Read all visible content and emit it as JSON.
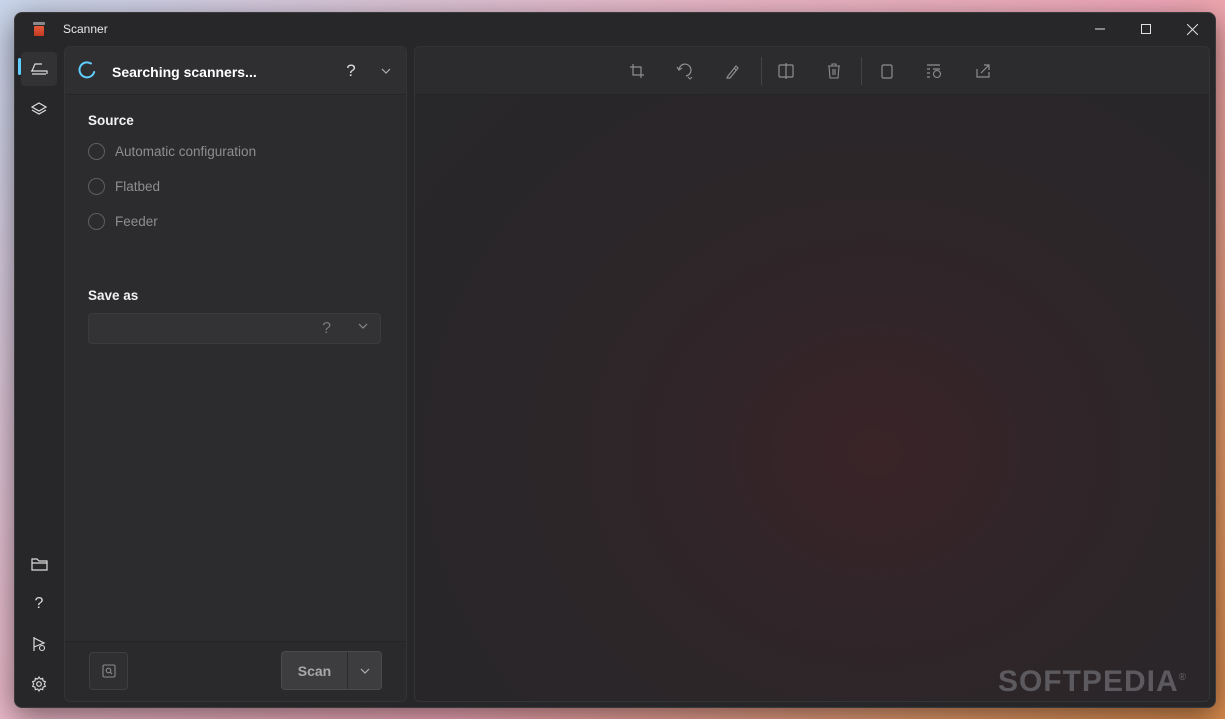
{
  "window": {
    "title": "Scanner"
  },
  "sidebar": {
    "items": [
      {
        "name": "scan-page-icon",
        "active": true
      },
      {
        "name": "layers-icon"
      },
      {
        "name": "folder-icon"
      },
      {
        "name": "help-icon"
      },
      {
        "name": "feedback-icon"
      },
      {
        "name": "settings-icon"
      }
    ]
  },
  "scanner_panel": {
    "status": "Searching scanners...",
    "help_glyph": "?",
    "source": {
      "title": "Source",
      "options": [
        "Automatic configuration",
        "Flatbed",
        "Feeder"
      ]
    },
    "save_as": {
      "title": "Save as",
      "value": "",
      "help_glyph": "?"
    },
    "footer": {
      "scan_label": "Scan"
    }
  },
  "toolbar": {
    "icons": [
      "crop-icon",
      "rotate-icon",
      "draw-icon",
      "split-icon",
      "delete-icon",
      "copy-icon",
      "reorder-icon",
      "share-icon"
    ]
  },
  "watermark": {
    "text": "SOFTPEDIA",
    "mark": "®"
  },
  "colors": {
    "accent": "#60cdff",
    "window_bg": "#272729",
    "panel_bg": "#2c2b2e"
  }
}
